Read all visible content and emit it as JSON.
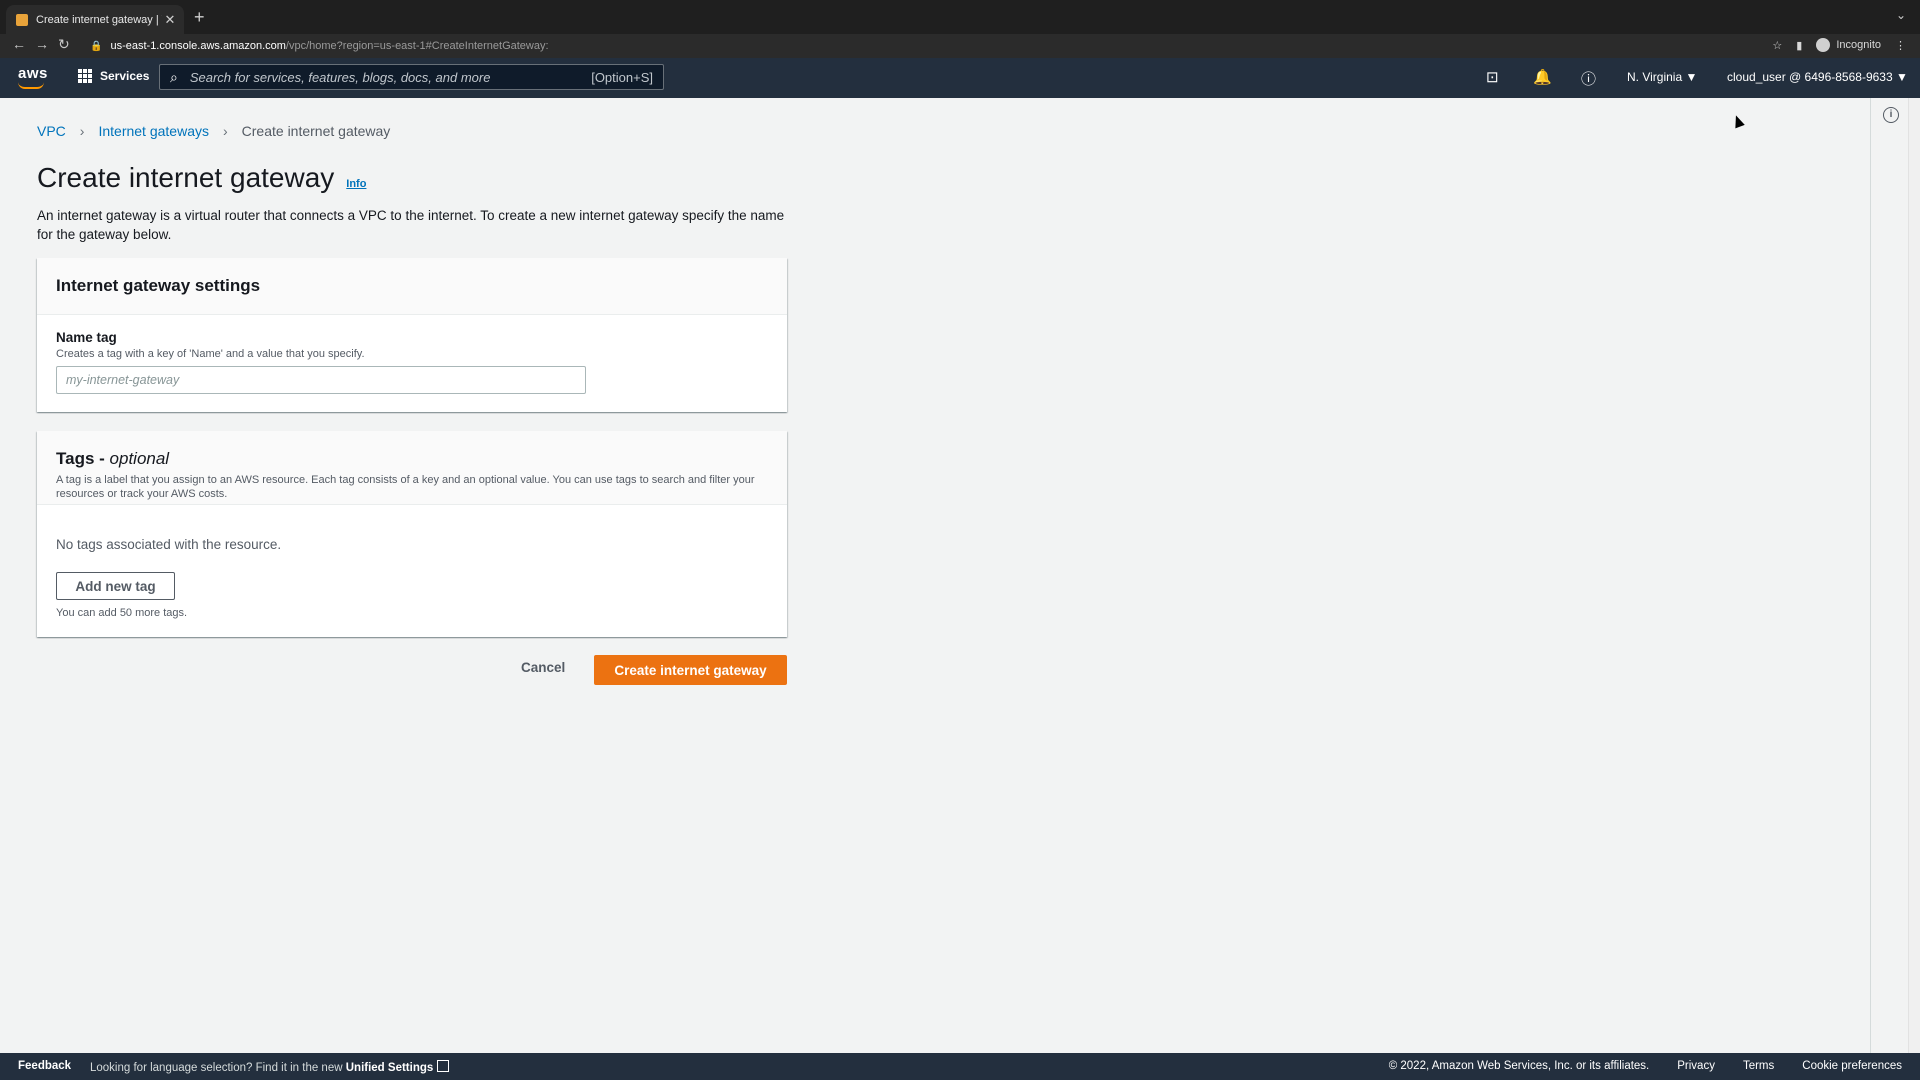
{
  "browser": {
    "tab_title": "Create internet gateway | VPC",
    "url_host": "us-east-1.console.aws.amazon.com",
    "url_path": "/vpc/home?region=us-east-1#CreateInternetGateway:",
    "incognito_label": "Incognito"
  },
  "aws_nav": {
    "logo": "aws",
    "services_label": "Services",
    "search_placeholder": "Search for services, features, blogs, docs, and more",
    "search_shortcut": "[Option+S]",
    "region": "N. Virginia ▼",
    "account": "cloud_user @ 6496-8568-9633 ▼"
  },
  "breadcrumb": {
    "items": [
      "VPC",
      "Internet gateways"
    ],
    "current": "Create internet gateway"
  },
  "page": {
    "title": "Create internet gateway",
    "info_link": "Info",
    "description": "An internet gateway is a virtual router that connects a VPC to the internet. To create a new internet gateway specify the name for the gateway below."
  },
  "settings_card": {
    "heading": "Internet gateway settings",
    "name_tag_label": "Name tag",
    "name_tag_description": "Creates a tag with a key of 'Name' and a value that you specify.",
    "name_tag_placeholder": "my-internet-gateway",
    "name_tag_value": ""
  },
  "tags_card": {
    "heading": "Tags - ",
    "heading_optional": "optional",
    "description": "A tag is a label that you assign to an AWS resource. Each tag consists of a key and an optional value. You can use tags to search and filter your resources or track your AWS costs.",
    "empty_text": "No tags associated with the resource.",
    "add_button": "Add new tag",
    "limit_hint": "You can add 50 more tags."
  },
  "actions": {
    "cancel": "Cancel",
    "create": "Create internet gateway"
  },
  "footer": {
    "feedback": "Feedback",
    "language_msg": "Looking for language selection? Find it in the new ",
    "unified_settings": "Unified Settings",
    "copyright": "© 2022, Amazon Web Services, Inc. or its affiliates.",
    "privacy": "Privacy",
    "terms": "Terms",
    "cookie": "Cookie preferences"
  },
  "colors": {
    "primary_button": "#ec7211",
    "link": "#0073bb",
    "nav_bg": "#232f3e"
  },
  "icons": [
    "grid-icon",
    "search-icon",
    "cloudshell-icon",
    "bell-icon",
    "help-icon",
    "info-icon",
    "external-link-icon",
    "lock-icon",
    "star-icon"
  ]
}
